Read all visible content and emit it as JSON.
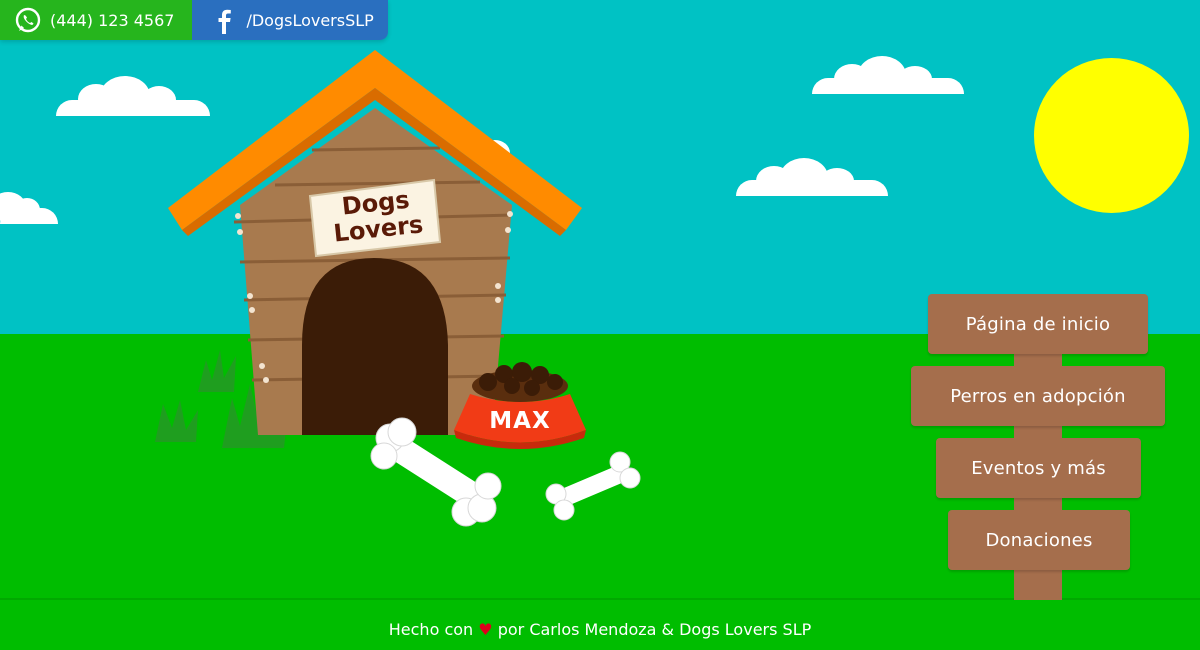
{
  "contact": {
    "phone": "(444) 123 4567",
    "facebook_handle": "/DogsLoversSLP",
    "phone_icon": "whatsapp-icon",
    "facebook_icon": "facebook-icon"
  },
  "scene": {
    "sign_line1": "Dogs",
    "sign_line2": "Lovers",
    "bowl_label": "MAX"
  },
  "nav": {
    "items": [
      {
        "label": "Página de inicio"
      },
      {
        "label": "Perros en adopción"
      },
      {
        "label": "Eventos y más"
      },
      {
        "label": "Donaciones"
      }
    ]
  },
  "footer": {
    "prefix": "Hecho con",
    "heart": "♥",
    "suffix": "por Carlos Mendoza & Dogs Lovers SLP"
  },
  "colors": {
    "sky": "#00c2c4",
    "grass": "#00bd00",
    "sun": "#ffff00",
    "wood": "#a56e4c",
    "roof": "#ff8c00",
    "whatsapp": "#26b51d",
    "facebook": "#2a6fbf"
  }
}
